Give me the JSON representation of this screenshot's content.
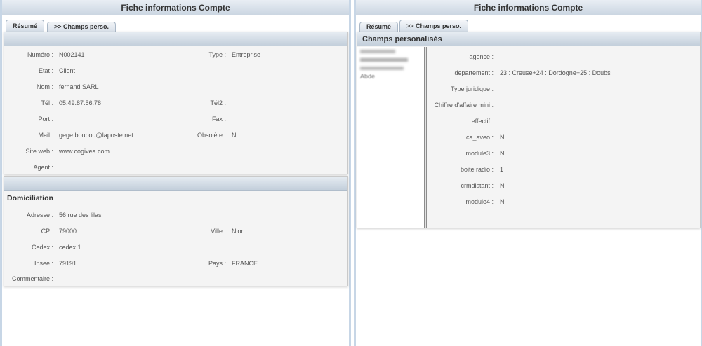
{
  "left": {
    "title": "Fiche informations Compte",
    "tabs": [
      {
        "label": "Résumé"
      },
      {
        "label": ">> Champs perso."
      }
    ],
    "summary": {
      "numero_label": "Numéro :",
      "numero_value": "N002141",
      "type_label": "Type :",
      "type_value": "Entreprise",
      "etat_label": "Etat :",
      "etat_value": "Client",
      "nom_label": "Nom :",
      "nom_value": "fernand SARL",
      "tel_label": "Tél :",
      "tel_value": "05.49.87.56.78",
      "tel2_label": "Tél2 :",
      "port_label": "Port :",
      "fax_label": "Fax :",
      "mail_label": "Mail :",
      "mail_value": "gege.boubou@laposte.net",
      "obsolete_label": "Obsolète :",
      "obsolete_value": "N",
      "site_label": "Site web :",
      "site_value": "www.cogivea.com",
      "agent_label": "Agent :"
    },
    "domiciliation": {
      "title": "Domiciliation",
      "adresse_label": "Adresse :",
      "adresse_value": "56 rue des lilas",
      "cp_label": "CP :",
      "cp_value": "79000",
      "ville_label": "Ville :",
      "ville_value": "Niort",
      "cedex_label": "Cedex :",
      "cedex_value": "cedex 1",
      "insee_label": "Insee :",
      "insee_value": "79191",
      "pays_label": "Pays :",
      "pays_value": "FRANCE",
      "commentaire_label": "Commentaire :"
    }
  },
  "right": {
    "title": "Fiche informations Compte",
    "tabs": [
      {
        "label": "Résumé"
      },
      {
        "label": ">> Champs perso."
      }
    ],
    "section_title": "Champs personalisés",
    "list_items": [
      "Abde"
    ],
    "fields": [
      {
        "label": "agence :",
        "value": ""
      },
      {
        "label": "departement :",
        "value": "23 : Creuse+24 : Dordogne+25 : Doubs"
      },
      {
        "label": "Type juridique :",
        "value": ""
      },
      {
        "label": "Chiffre d'affaire mini :",
        "value": ""
      },
      {
        "label": "effectif :",
        "value": ""
      },
      {
        "label": "ca_aveo :",
        "value": "N"
      },
      {
        "label": "module3 :",
        "value": "N"
      },
      {
        "label": "boite radio :",
        "value": "1"
      },
      {
        "label": "crmdistant :",
        "value": "N"
      },
      {
        "label": "module4 :",
        "value": "N"
      }
    ]
  },
  "colors": {
    "frame": "#c7d6e6",
    "header_top": "#e9eef4",
    "header_bottom": "#cbd6e2",
    "content_bg": "#f4f4f4"
  }
}
